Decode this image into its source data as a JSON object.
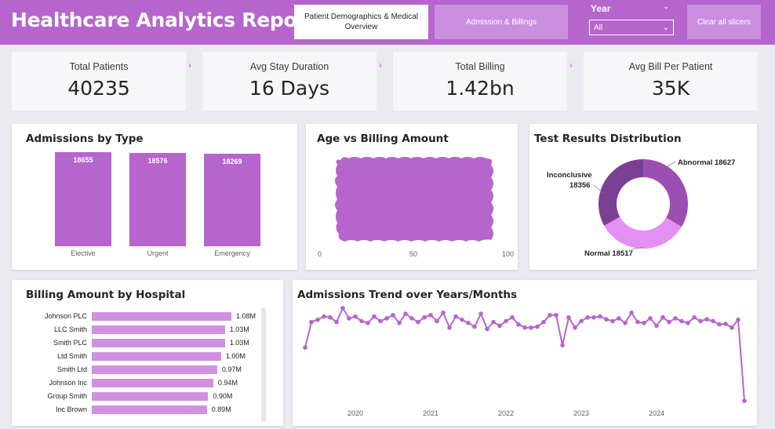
{
  "header": {
    "title": "Healthcare Analytics Report",
    "tabs": [
      {
        "label": "Patient Demographics & Medical Overview"
      },
      {
        "label": "Admission & Billings"
      }
    ],
    "year_slicer": {
      "label": "Year",
      "value": "All"
    },
    "clear_label": "Clear all slicers"
  },
  "kpis": [
    {
      "label": "Total Patients",
      "value": "40235"
    },
    {
      "label": "Avg Stay Duration",
      "value": "16 Days"
    },
    {
      "label": "Total Billing",
      "value": "1.42bn"
    },
    {
      "label": "Avg Bill Per Patient",
      "value": "35K"
    }
  ],
  "colors": {
    "accent": "#b565cc",
    "accent_light": "#cf91e0",
    "donut_abnormal": "#9c4fb3",
    "donut_inconclusive": "#7b3f93",
    "donut_normal": "#e48ff2"
  },
  "chart_data": [
    {
      "type": "bar",
      "title": "Admissions by Type",
      "categories": [
        "Elective",
        "Urgent",
        "Emergency"
      ],
      "values": [
        18655,
        18576,
        18269
      ],
      "value_labels": [
        "18655",
        "18576",
        "18269"
      ]
    },
    {
      "type": "scatter",
      "title": "Age vs Billing Amount",
      "x_ticks": [
        "0",
        "50",
        "100"
      ],
      "xlim": [
        0,
        100
      ]
    },
    {
      "type": "pie",
      "title": "Test Results Distribution",
      "labels": [
        "Abnormal",
        "Normal",
        "Inconclusive"
      ],
      "values": [
        18627,
        18517,
        18356
      ],
      "callouts": [
        "Abnormal 18627",
        "Normal 18517",
        "Inconclusive",
        "18356"
      ]
    },
    {
      "type": "bar",
      "orientation": "horizontal",
      "title": "Billing Amount by Hospital",
      "categories": [
        "Johnson PLC",
        "LLC Smith",
        "Smith PLC",
        "Ltd Smith",
        "Smith Ltd",
        "Johnson Inc",
        "Group Smith",
        "Inc Brown"
      ],
      "values": [
        1.08,
        1.03,
        1.03,
        1.0,
        0.97,
        0.94,
        0.9,
        0.89
      ],
      "value_labels": [
        "1.08M",
        "1.03M",
        "1.03M",
        "1.00M",
        "0.97M",
        "0.94M",
        "0.90M",
        "0.89M"
      ],
      "unit": "M"
    },
    {
      "type": "line",
      "title": "Admissions Trend over Years/Months",
      "x_ticks": [
        "2020",
        "2021",
        "2022",
        "2023",
        "2024"
      ],
      "start": "2019-05",
      "values": [
        555,
        610,
        615,
        622,
        620,
        610,
        640,
        618,
        622,
        612,
        608,
        622,
        612,
        618,
        625,
        608,
        628,
        618,
        610,
        620,
        625,
        612,
        630,
        598,
        622,
        615,
        608,
        600,
        628,
        595,
        610,
        602,
        612,
        620,
        605,
        598,
        598,
        600,
        610,
        625,
        625,
        560,
        620,
        598,
        612,
        620,
        620,
        622,
        616,
        612,
        618,
        608,
        630,
        610,
        608,
        618,
        602,
        620,
        610,
        618,
        612,
        608,
        620,
        612,
        616,
        612,
        605,
        606,
        598,
        615,
        440
      ],
      "ylim": [
        430,
        650
      ]
    }
  ]
}
